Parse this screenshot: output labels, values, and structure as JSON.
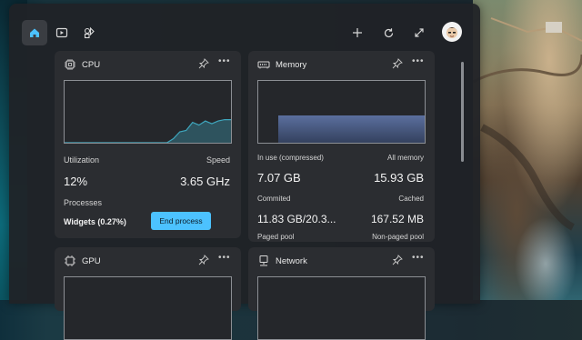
{
  "toolbar": {
    "tabs": [
      "home-icon",
      "video-icon",
      "widgets-icon"
    ],
    "actions": [
      "add-icon",
      "refresh-icon",
      "expand-icon"
    ]
  },
  "cpu": {
    "title": "CPU",
    "utilization_label": "Utilization",
    "speed_label": "Speed",
    "utilization_value": "12%",
    "speed_value": "3.65 GHz",
    "processes_label": "Processes",
    "process_name": "Widgets (0.27%)",
    "end_process_label": "End process",
    "history": [
      0,
      0,
      0,
      0,
      0,
      0,
      0,
      0,
      0,
      0,
      0,
      0,
      0,
      0,
      0,
      0,
      0,
      3,
      8,
      9,
      15,
      13,
      16,
      14,
      16,
      17,
      17
    ]
  },
  "memory": {
    "title": "Memory",
    "in_use_label": "In use (compressed)",
    "all_memory_label": "All memory",
    "in_use_value": "7.07 GB",
    "all_memory_value": "15.93 GB",
    "committed_label": "Commited",
    "cached_label": "Cached",
    "committed_value": "11.83 GB/20.3...",
    "cached_value": "167.52 MB",
    "paged_pool_label": "Paged pool",
    "non_paged_pool_label": "Non-paged pool",
    "usage_fraction": 0.44
  },
  "gpu": {
    "title": "GPU"
  },
  "network": {
    "title": "Network"
  },
  "colors": {
    "accent": "#4cc2ff",
    "graph_line": "#3ea6bd",
    "memory_fill": "#4a5b82"
  }
}
